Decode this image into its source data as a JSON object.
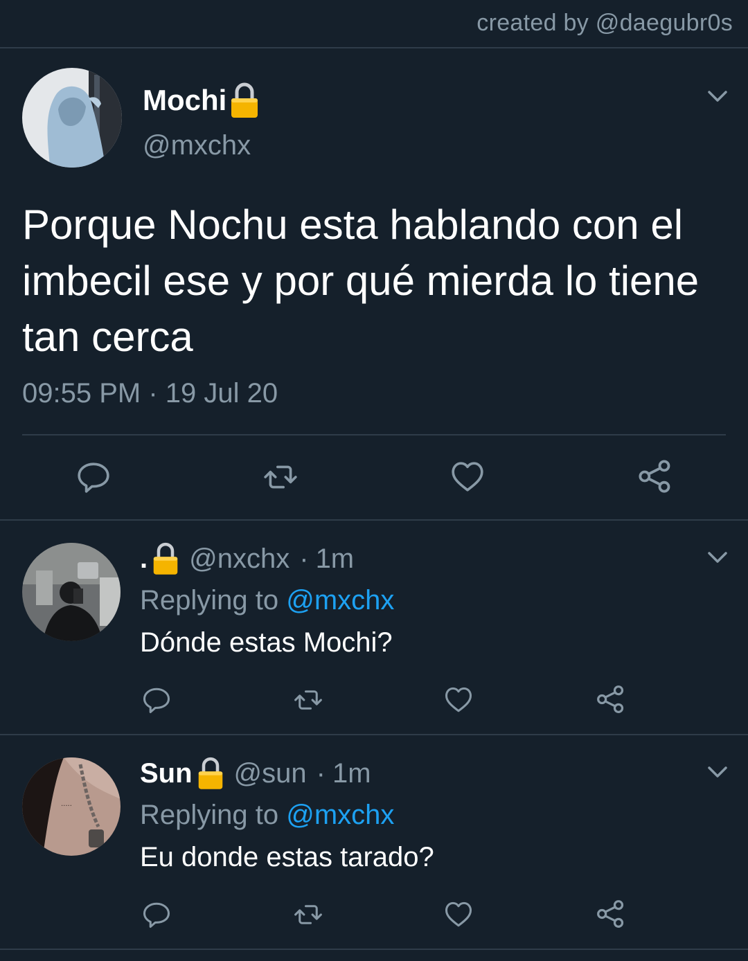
{
  "credit": "created by @daegubr0s",
  "main_tweet": {
    "name": "Mochi",
    "handle": "@mxchx",
    "text": "Porque Nochu esta hablando con el imbecil ese y por qué mierda lo tiene tan cerca",
    "timestamp": "09:55 PM · 19 Jul 20",
    "icons": [
      "lock-icon",
      "chevron-down-icon",
      "reply-icon",
      "retweet-icon",
      "like-icon",
      "share-icon"
    ]
  },
  "replies": [
    {
      "name": ".",
      "handle": "@nxchx",
      "time": "1m",
      "replying_prefix": "Replying to",
      "replying_to": "@mxchx",
      "text": "Dónde estas Mochi?"
    },
    {
      "name": "Sun",
      "handle": "@sun",
      "time": "1m",
      "replying_prefix": "Replying to",
      "replying_to": "@mxchx",
      "text": "Eu donde estas tarado?"
    }
  ],
  "colors": {
    "background": "#15202b",
    "secondary_text": "#8899a6",
    "mention": "#1da1f2",
    "divider": "#2f3c49",
    "lock": "#f5b400"
  }
}
